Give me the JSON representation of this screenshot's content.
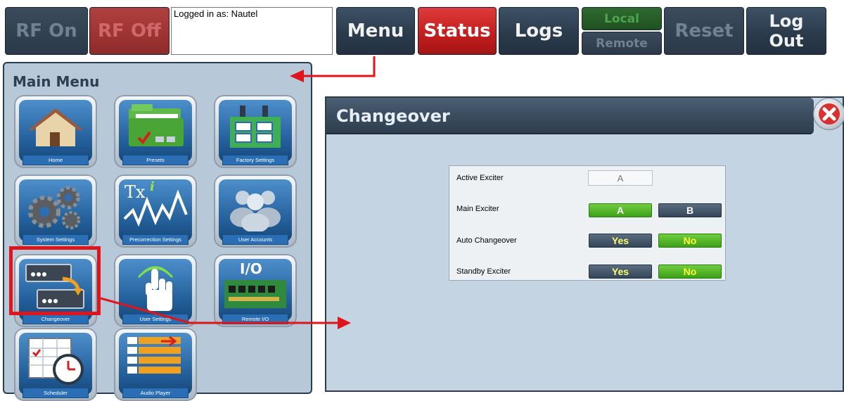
{
  "toolbar": {
    "rf_on": "RF On",
    "rf_off": "RF Off",
    "logged_in": "Logged in as: Nautel",
    "menu": "Menu",
    "status": "Status",
    "logs": "Logs",
    "local": "Local",
    "remote": "Remote",
    "reset": "Reset",
    "logout_line1": "Log",
    "logout_line2": "Out"
  },
  "main_menu": {
    "title": "Main Menu",
    "tiles": [
      {
        "label": "Home",
        "icon": "home-icon"
      },
      {
        "label": "Presets",
        "icon": "folder-icon"
      },
      {
        "label": "Factory Settings",
        "icon": "factory-icon"
      },
      {
        "label": "System Settings",
        "icon": "gears-icon"
      },
      {
        "label": "Precorrection Settings",
        "icon": "txi-waveform-icon"
      },
      {
        "label": "User Accounts",
        "icon": "users-icon"
      },
      {
        "label": "Changeover",
        "icon": "changeover-icon"
      },
      {
        "label": "User Settings",
        "icon": "touch-hand-icon"
      },
      {
        "label": "Remote I/O",
        "icon": "io-board-icon"
      },
      {
        "label": "Scheduler",
        "icon": "calendar-clock-icon"
      },
      {
        "label": "Audio Player",
        "icon": "playlist-icon"
      }
    ],
    "tile_icon_texts": {
      "precorrection": "Tx",
      "precorrection_sup": "i",
      "io": "I/O"
    }
  },
  "changeover": {
    "title": "Changeover",
    "rows": {
      "active_exciter": {
        "label": "Active Exciter",
        "value": "A"
      },
      "main_exciter": {
        "label": "Main Exciter",
        "option_a": "A",
        "option_b": "B",
        "selected": "A"
      },
      "auto_changeover": {
        "label": "Auto Changeover",
        "yes": "Yes",
        "no": "No",
        "selected": "No"
      },
      "standby_exciter": {
        "label": "Standby Exciter",
        "yes": "Yes",
        "no": "No",
        "selected": "No"
      }
    }
  },
  "colors": {
    "accent_red": "#e0141b",
    "toolbar_dark": "#2b3b4c",
    "status_red": "#c11d1d",
    "selected_green": "#3e9f1a",
    "panel_bg": "#b7c8d8"
  }
}
